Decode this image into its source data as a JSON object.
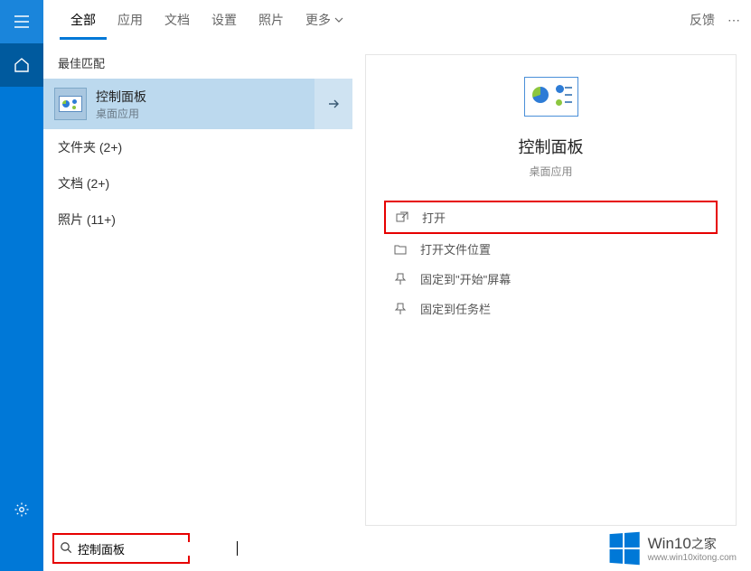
{
  "tabs": {
    "all": "全部",
    "apps": "应用",
    "docs": "文档",
    "settings": "设置",
    "photos": "照片",
    "more": "更多"
  },
  "header": {
    "feedback": "反馈",
    "more": "⋯"
  },
  "results": {
    "best_match": "最佳匹配",
    "item": {
      "title": "控制面板",
      "sub": "桌面应用"
    },
    "folders": "文件夹 (2+)",
    "documents": "文档 (2+)",
    "photos": "照片 (11+)"
  },
  "detail": {
    "title": "控制面板",
    "sub": "桌面应用",
    "actions": {
      "open": "打开",
      "open_location": "打开文件位置",
      "pin_start": "固定到\"开始\"屏幕",
      "pin_taskbar": "固定到任务栏"
    }
  },
  "search": {
    "value": "控制面板"
  },
  "watermark": {
    "brand": "Win10",
    "suffix": "之家",
    "url": "www.win10xitong.com"
  }
}
